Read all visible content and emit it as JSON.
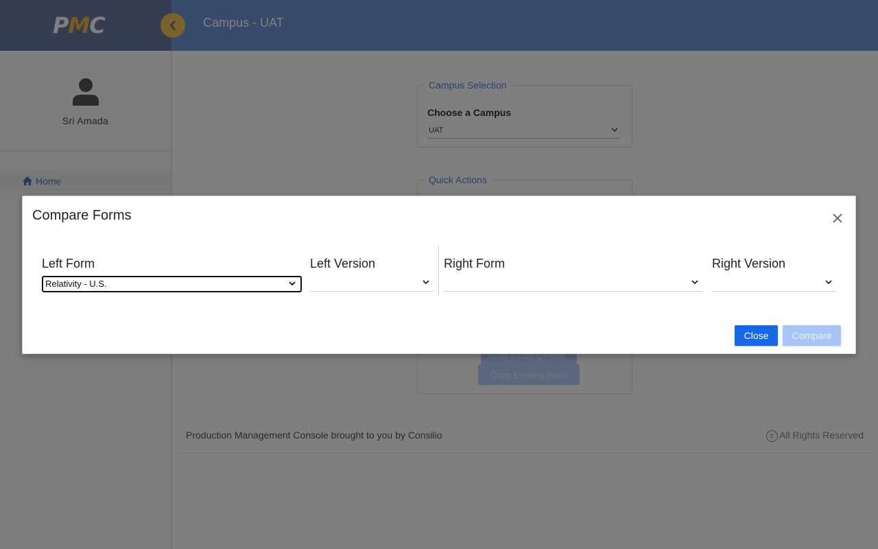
{
  "header": {
    "logo": "PMC",
    "title": "Campus - UAT"
  },
  "sidebar": {
    "user_name": "Sri Amada",
    "items": [
      {
        "label": "Home",
        "icon": "home-icon"
      }
    ]
  },
  "main": {
    "campus_selection": {
      "legend": "Campus Selection",
      "label": "Choose a Campus",
      "value": "UAT"
    },
    "quick_actions": {
      "legend": "Quick Actions",
      "buttons": [
        "Edit Existing Form",
        "Copy Existing Form"
      ]
    }
  },
  "footer": {
    "text": "Production Management Console brought to you by Consilio",
    "copyright": "All Rights Reserved"
  },
  "modal": {
    "title": "Compare Forms",
    "left_form": {
      "label": "Left Form",
      "value": "Relativity - U.S."
    },
    "left_version": {
      "label": "Left Version",
      "value": ""
    },
    "right_form": {
      "label": "Right Form",
      "value": ""
    },
    "right_version": {
      "label": "Right Version",
      "value": ""
    },
    "close_label": "Close",
    "compare_label": "Compare"
  },
  "colors": {
    "header": "#6f94d6",
    "primary_button": "#1668e8",
    "disabled_button": "#a7c5f7",
    "accent": "#f5c45b"
  }
}
